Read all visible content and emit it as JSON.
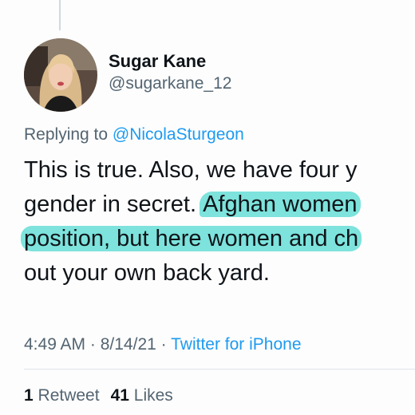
{
  "author": {
    "display_name": "Sugar Kane",
    "handle": "@sugarkane_12"
  },
  "reply": {
    "prefix": "Replying to",
    "mention": "@NicolaSturgeon"
  },
  "tweet": {
    "line1": "This is true. Also, we have four y",
    "line2_plain": "gender in secret. ",
    "line2_highlight": "Afghan women",
    "line3_highlight": "position, but here women and ch",
    "line4": "out your own back yard."
  },
  "meta": {
    "time": "4:49 AM",
    "dot1": " · ",
    "date": "8/14/21",
    "dot2": " · ",
    "source": "Twitter for iPhone"
  },
  "stats": {
    "retweets_count": "1",
    "retweets_label": "Retweet",
    "likes_count": "41",
    "likes_label": "Likes"
  },
  "colors": {
    "highlight": "#7de3dc",
    "link": "#1d9bf0",
    "secondary_text": "#536471",
    "primary_text": "#0f1419"
  },
  "icons": {
    "avatar": "profile-photo"
  }
}
